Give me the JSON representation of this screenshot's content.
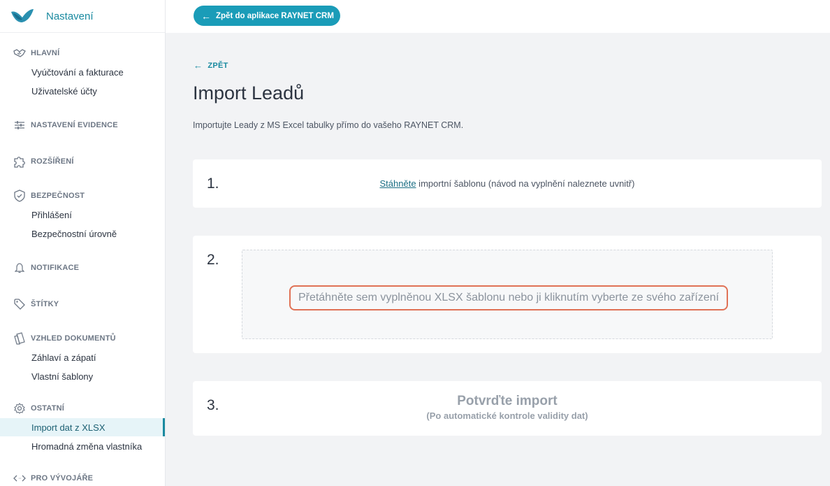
{
  "sidebar": {
    "title": "Nastavení",
    "sections": [
      {
        "id": "hlavni",
        "label": "HLAVNÍ",
        "icon": "handshake-icon"
      },
      {
        "id": "evidence",
        "label": "NASTAVENÍ EVIDENCE",
        "icon": "sliders-icon"
      },
      {
        "id": "rozsireni",
        "label": "ROZŠÍŘENÍ",
        "icon": "puzzle-icon"
      },
      {
        "id": "bezpecnost",
        "label": "BEZPEČNOST",
        "icon": "shield-icon"
      },
      {
        "id": "notifikace",
        "label": "NOTIFIKACE",
        "icon": "bell-icon"
      },
      {
        "id": "stitky",
        "label": "ŠTÍTKY",
        "icon": "tag-icon"
      },
      {
        "id": "vzhled",
        "label": "VZHLED DOKUMENTŮ",
        "icon": "documents-icon"
      },
      {
        "id": "ostatni",
        "label": "OSTATNÍ",
        "icon": "gear-icon"
      },
      {
        "id": "vyvojari",
        "label": "PRO VÝVOJÁŘE",
        "icon": "code-icon"
      }
    ],
    "items": {
      "billing": "Vyúčtování a fakturace",
      "users": "Uživatelské účty",
      "login": "Přihlášení",
      "security_levels": "Bezpečnostní úrovně",
      "header_footer": "Záhlaví a zápatí",
      "templates": "Vlastní šablony",
      "import_xlsx": "Import dat z XLSX",
      "owner_change": "Hromadná změna vlastníka"
    }
  },
  "topbar": {
    "back_app_label": "Zpět do aplikace RAYNET CRM"
  },
  "main": {
    "back_label": "ZPĚT",
    "title": "Import Leadů",
    "description": "Importujte Leady z MS Excel tabulky přímo do vašeho RAYNET CRM.",
    "step1": {
      "number": "1.",
      "link": "Stáhněte",
      "text": " importní šablonu (návod na vyplnění naleznete uvnitř)"
    },
    "step2": {
      "number": "2.",
      "dropzone_text": "Přetáhněte sem vyplněnou XLSX šablonu nebo ji kliknutím vyberte ze svého zařízení"
    },
    "step3": {
      "number": "3.",
      "title": "Potvrďte import",
      "subtitle": "(Po automatické kontrole validity dat)"
    }
  },
  "colors": {
    "accent": "#1a9cb8",
    "highlight": "#e07256"
  }
}
